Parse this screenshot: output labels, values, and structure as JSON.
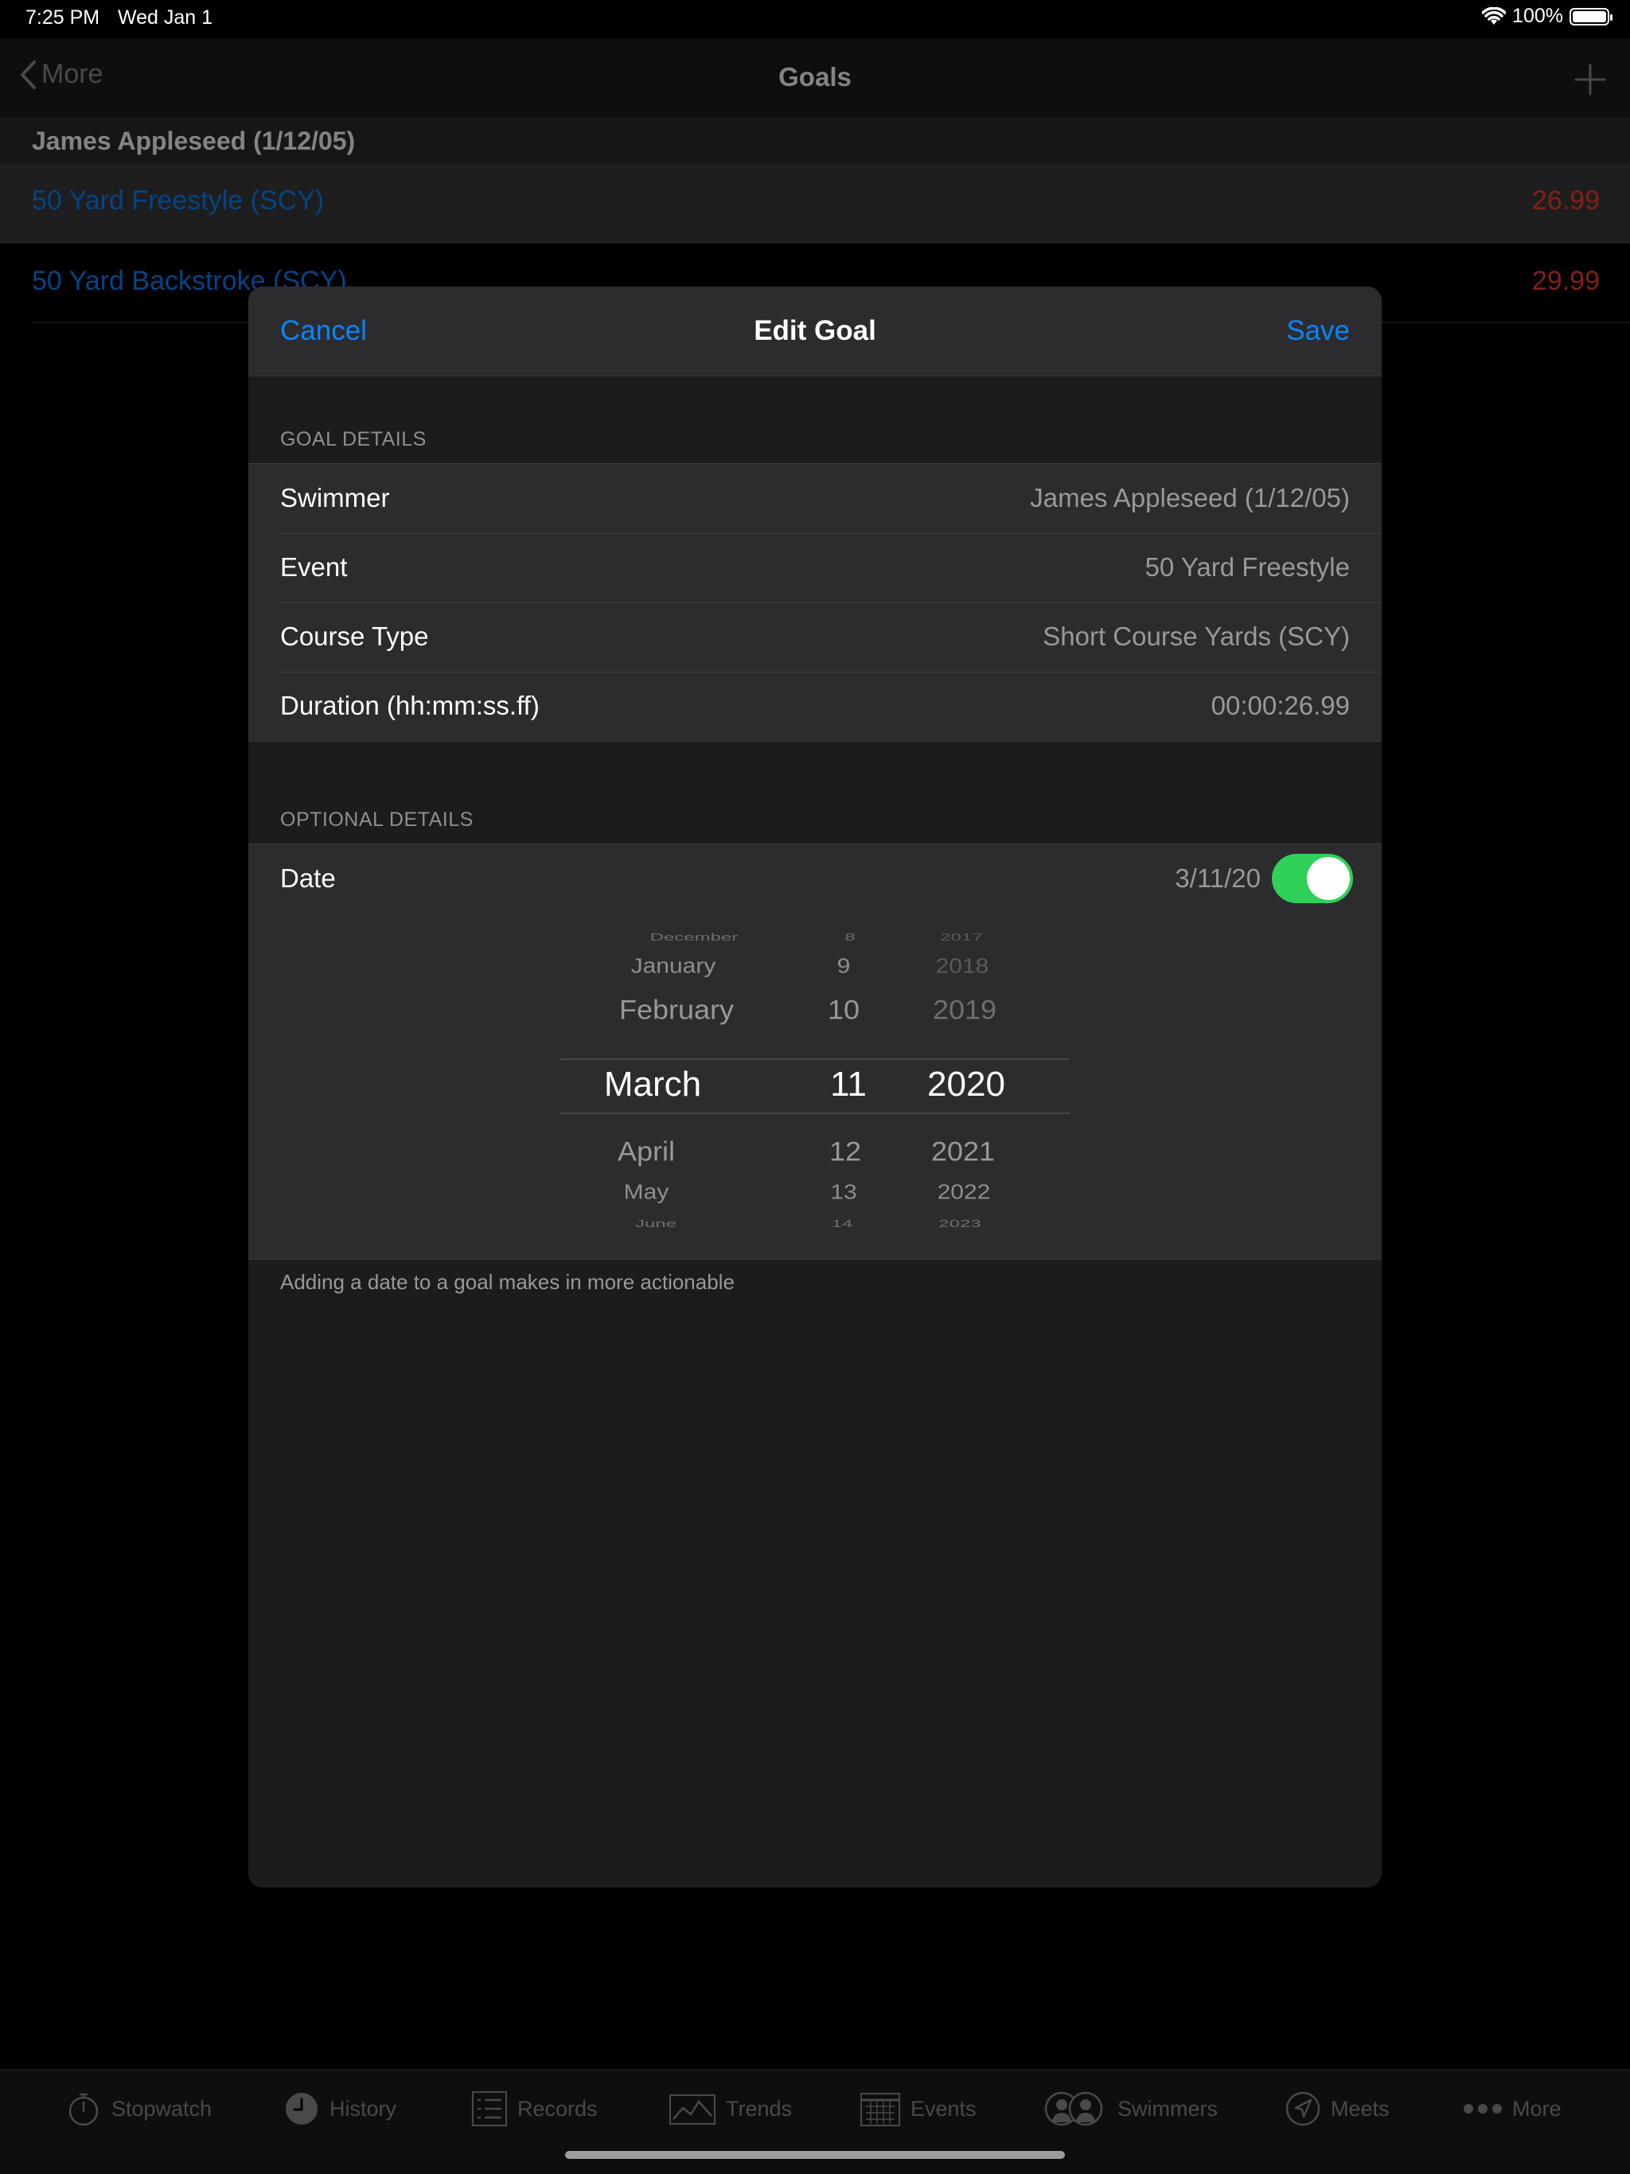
{
  "status_bar": {
    "time": "7:25 PM",
    "date": "Wed Jan 1",
    "battery": "100%",
    "battery_level": 1.0
  },
  "nav": {
    "back_label": "More",
    "title": "Goals",
    "add_icon": "plus-icon"
  },
  "list": {
    "section_title": "James Appleseed (1/12/05)",
    "rows": [
      {
        "name": "50 Yard Freestyle (SCY)",
        "time": "26.99"
      },
      {
        "name": "50 Yard Backstroke (SCY)",
        "time": "29.99"
      }
    ]
  },
  "modal": {
    "cancel_label": "Cancel",
    "title": "Edit Goal",
    "save_label": "Save",
    "goal_details_header": "GOAL DETAILS",
    "goal_details": [
      {
        "label": "Swimmer",
        "value": "James Appleseed (1/12/05)"
      },
      {
        "label": "Event",
        "value": "50 Yard Freestyle"
      },
      {
        "label": "Course Type",
        "value": "Short Course Yards (SCY)"
      },
      {
        "label": "Duration (hh:mm:ss.ff)",
        "value": "00:00:26.99"
      }
    ],
    "optional_details_header": "OPTIONAL DETAILS",
    "date_label": "Date",
    "date_value": "3/11/20",
    "date_enabled": true,
    "footer_note": "Adding a date to a goal makes in more actionable",
    "picker": {
      "months": [
        "December",
        "January",
        "February",
        "March",
        "April",
        "May",
        "June"
      ],
      "days": [
        "8",
        "9",
        "10",
        "11",
        "12",
        "13",
        "14"
      ],
      "years": [
        "2017",
        "2018",
        "2019",
        "2020",
        "2021",
        "2022",
        "2023"
      ],
      "selected_index": 3
    }
  },
  "tab_bar": {
    "tabs": [
      {
        "label": "Stopwatch",
        "icon": "stopwatch-icon"
      },
      {
        "label": "History",
        "icon": "clock-icon"
      },
      {
        "label": "Records",
        "icon": "list-icon"
      },
      {
        "label": "Trends",
        "icon": "chart-icon"
      },
      {
        "label": "Events",
        "icon": "calendar-icon"
      },
      {
        "label": "Swimmers",
        "icon": "people-icon"
      },
      {
        "label": "Meets",
        "icon": "location-arrow-icon"
      },
      {
        "label": "More",
        "icon": "ellipsis-icon"
      }
    ]
  },
  "colors": {
    "accent": "#0a84ff",
    "time_red": "#ff3b30",
    "toggle_on": "#30d158"
  }
}
